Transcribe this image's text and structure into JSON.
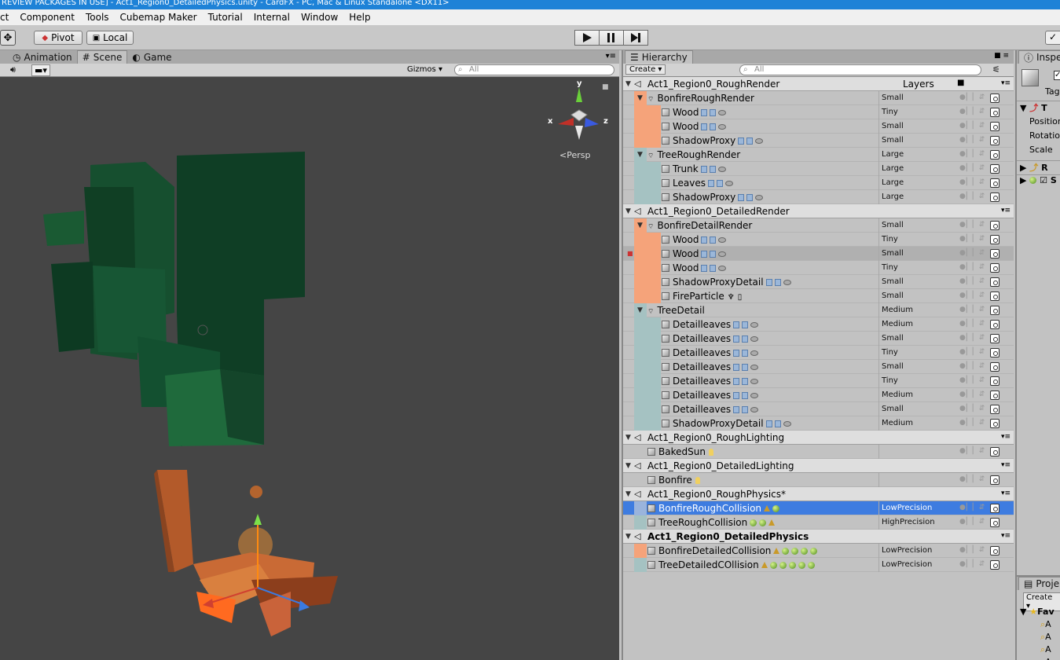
{
  "window": {
    "title": "REVIEW PACKAGES IN USE] - Act1_Region0_DetailedPhysics.unity - CardFX - PC, Mac & Linux Standalone <DX11>"
  },
  "menu": [
    "ct",
    "Component",
    "Tools",
    "Cubemap Maker",
    "Tutorial",
    "Internal",
    "Window",
    "Help"
  ],
  "toolbar": {
    "pivot": "Pivot",
    "local": "Local"
  },
  "scene_tabs": {
    "animation": "Animation",
    "scene": "Scene",
    "game": "Game"
  },
  "scene_toolbar": {
    "gizmos": "Gizmos",
    "search_placeholder": "All"
  },
  "scene_view": {
    "persp_label": "Persp",
    "axis_x": "x",
    "axis_y": "y",
    "axis_z": "z"
  },
  "hierarchy": {
    "tab_label": "Hierarchy",
    "create_label": "Create",
    "search_placeholder": "All",
    "layers_header": "Layers",
    "rows": [
      {
        "type": "scene",
        "name": "Act1_Region0_RoughRender",
        "bold": false
      },
      {
        "depth": 1,
        "name": "BonfireRoughRender",
        "layer": "Small",
        "band": "orange",
        "icons": ""
      },
      {
        "depth": 2,
        "name": "Wood",
        "layer": "Tiny",
        "band": "orange",
        "icons": "mr"
      },
      {
        "depth": 2,
        "name": "Wood",
        "layer": "Small",
        "band": "orange",
        "icons": "mr"
      },
      {
        "depth": 2,
        "name": "ShadowProxy",
        "layer": "Small",
        "band": "orange",
        "icons": "mr"
      },
      {
        "depth": 1,
        "name": "TreeRoughRender",
        "layer": "Large",
        "band": "teal",
        "icons": ""
      },
      {
        "depth": 2,
        "name": "Trunk",
        "layer": "Large",
        "band": "teal",
        "icons": "mr"
      },
      {
        "depth": 2,
        "name": "Leaves",
        "layer": "Large",
        "band": "teal",
        "icons": "mr"
      },
      {
        "depth": 2,
        "name": "ShadowProxy",
        "layer": "Large",
        "band": "teal",
        "icons": "mr"
      },
      {
        "type": "scene",
        "name": "Act1_Region0_DetailedRender",
        "bold": false
      },
      {
        "depth": 1,
        "name": "BonfireDetailRender",
        "layer": "Small",
        "band": "orange",
        "icons": ""
      },
      {
        "depth": 2,
        "name": "Wood",
        "layer": "Tiny",
        "band": "orange",
        "icons": "mr"
      },
      {
        "depth": 2,
        "name": "Wood",
        "layer": "Small",
        "band": "orange",
        "icons": "mr",
        "hl": true
      },
      {
        "depth": 2,
        "name": "Wood",
        "layer": "Tiny",
        "band": "orange",
        "icons": "mr"
      },
      {
        "depth": 2,
        "name": "ShadowProxyDetail",
        "layer": "Small",
        "band": "orange",
        "icons": "mr"
      },
      {
        "depth": 2,
        "name": "FireParticle",
        "layer": "Small",
        "band": "orange",
        "icons": "fx"
      },
      {
        "depth": 1,
        "name": "TreeDetail",
        "layer": "Medium",
        "band": "teal",
        "icons": ""
      },
      {
        "depth": 2,
        "name": "Detailleaves",
        "layer": "Medium",
        "band": "teal",
        "icons": "mr"
      },
      {
        "depth": 2,
        "name": "Detailleaves",
        "layer": "Small",
        "band": "teal",
        "icons": "mr"
      },
      {
        "depth": 2,
        "name": "Detailleaves",
        "layer": "Tiny",
        "band": "teal",
        "icons": "mr"
      },
      {
        "depth": 2,
        "name": "Detailleaves",
        "layer": "Small",
        "band": "teal",
        "icons": "mr"
      },
      {
        "depth": 2,
        "name": "Detailleaves",
        "layer": "Tiny",
        "band": "teal",
        "icons": "mr"
      },
      {
        "depth": 2,
        "name": "Detailleaves",
        "layer": "Medium",
        "band": "teal",
        "icons": "mr"
      },
      {
        "depth": 2,
        "name": "Detailleaves",
        "layer": "Small",
        "band": "teal",
        "icons": "mr"
      },
      {
        "depth": 2,
        "name": "ShadowProxyDetail",
        "layer": "Medium",
        "band": "teal",
        "icons": "mr"
      },
      {
        "type": "scene",
        "name": "Act1_Region0_RoughLighting",
        "bold": false
      },
      {
        "depth": 1,
        "name": "BakedSun",
        "layer": "",
        "band": "none",
        "icons": "light"
      },
      {
        "type": "scene",
        "name": "Act1_Region0_DetailedLighting",
        "bold": false
      },
      {
        "depth": 1,
        "name": "Bonfire",
        "layer": "",
        "band": "none",
        "icons": "light"
      },
      {
        "type": "scene",
        "name": "Act1_Region0_RoughPhysics*",
        "bold": false
      },
      {
        "depth": 1,
        "name": "BonfireRoughCollision",
        "layer": "LowPrecision",
        "band": "blue",
        "icons": "c1",
        "selected": true
      },
      {
        "depth": 1,
        "name": "TreeRoughCollision",
        "layer": "HighPrecision",
        "band": "teal",
        "icons": "c2"
      },
      {
        "type": "scene",
        "name": "Act1_Region0_DetailedPhysics",
        "bold": true
      },
      {
        "depth": 1,
        "name": "BonfireDetailedCollision",
        "layer": "LowPrecision",
        "band": "orange",
        "icons": "c4"
      },
      {
        "depth": 1,
        "name": "TreeDetailedCOllision",
        "layer": "LowPrecision",
        "band": "teal",
        "icons": "c5"
      }
    ]
  },
  "inspector": {
    "tab_label": "Inspe",
    "tag_label": "Tag",
    "transform_label": "T",
    "position": "Position",
    "rotation": "Rotatio",
    "scale": "Scale",
    "comp1": "R",
    "comp2": "S"
  },
  "project": {
    "tab_label": "Proje",
    "create_label": "Create",
    "favorites": "Fav",
    "items": [
      "A",
      "A",
      "A",
      "A"
    ]
  },
  "colors": {
    "orange_band": "#f5a37a",
    "teal_band": "#a5c2c2",
    "selected": "#3e7ce0"
  }
}
